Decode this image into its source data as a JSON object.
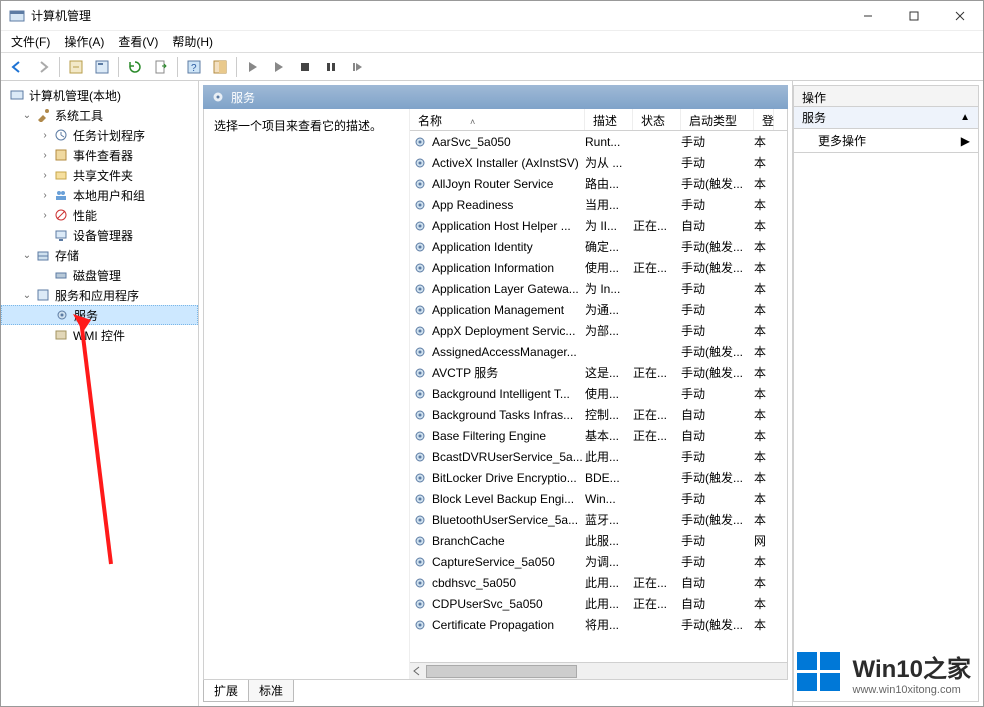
{
  "window": {
    "title": "计算机管理"
  },
  "menu": {
    "file": "文件(F)",
    "action": "操作(A)",
    "view": "查看(V)",
    "help": "帮助(H)"
  },
  "tree": {
    "root": "计算机管理(本地)",
    "sys_tools": "系统工具",
    "sys_children": {
      "task_scheduler": "任务计划程序",
      "event_viewer": "事件查看器",
      "shared_folders": "共享文件夹",
      "local_users": "本地用户和组",
      "performance": "性能",
      "device_manager": "设备管理器"
    },
    "storage": "存储",
    "storage_children": {
      "disk_mgmt": "磁盘管理"
    },
    "services_apps": "服务和应用程序",
    "services_apps_children": {
      "services": "服务",
      "wmi": "WMI 控件"
    }
  },
  "center": {
    "header": "服务",
    "description_prompt": "选择一个项目来查看它的描述。",
    "columns": {
      "name": "名称",
      "desc": "描述",
      "status": "状态",
      "startup": "启动类型",
      "logon": "登"
    },
    "tabs": {
      "extended": "扩展",
      "standard": "标准"
    }
  },
  "services": [
    {
      "name": "AarSvc_5a050",
      "desc": "Runt...",
      "status": "",
      "startup": "手动",
      "logon": "本"
    },
    {
      "name": "ActiveX Installer (AxInstSV)",
      "desc": "为从 ...",
      "status": "",
      "startup": "手动",
      "logon": "本"
    },
    {
      "name": "AllJoyn Router Service",
      "desc": "路由...",
      "status": "",
      "startup": "手动(触发...",
      "logon": "本"
    },
    {
      "name": "App Readiness",
      "desc": "当用...",
      "status": "",
      "startup": "手动",
      "logon": "本"
    },
    {
      "name": "Application Host Helper ...",
      "desc": "为 II...",
      "status": "正在...",
      "startup": "自动",
      "logon": "本"
    },
    {
      "name": "Application Identity",
      "desc": "确定...",
      "status": "",
      "startup": "手动(触发...",
      "logon": "本"
    },
    {
      "name": "Application Information",
      "desc": "使用...",
      "status": "正在...",
      "startup": "手动(触发...",
      "logon": "本"
    },
    {
      "name": "Application Layer Gatewa...",
      "desc": "为 In...",
      "status": "",
      "startup": "手动",
      "logon": "本"
    },
    {
      "name": "Application Management",
      "desc": "为通...",
      "status": "",
      "startup": "手动",
      "logon": "本"
    },
    {
      "name": "AppX Deployment Servic...",
      "desc": "为部...",
      "status": "",
      "startup": "手动",
      "logon": "本"
    },
    {
      "name": "AssignedAccessManager...",
      "desc": "",
      "status": "",
      "startup": "手动(触发...",
      "logon": "本"
    },
    {
      "name": "AVCTP 服务",
      "desc": "这是...",
      "status": "正在...",
      "startup": "手动(触发...",
      "logon": "本"
    },
    {
      "name": "Background Intelligent T...",
      "desc": "使用...",
      "status": "",
      "startup": "手动",
      "logon": "本"
    },
    {
      "name": "Background Tasks Infras...",
      "desc": "控制...",
      "status": "正在...",
      "startup": "自动",
      "logon": "本"
    },
    {
      "name": "Base Filtering Engine",
      "desc": "基本...",
      "status": "正在...",
      "startup": "自动",
      "logon": "本"
    },
    {
      "name": "BcastDVRUserService_5a...",
      "desc": "此用...",
      "status": "",
      "startup": "手动",
      "logon": "本"
    },
    {
      "name": "BitLocker Drive Encryptio...",
      "desc": "BDE...",
      "status": "",
      "startup": "手动(触发...",
      "logon": "本"
    },
    {
      "name": "Block Level Backup Engi...",
      "desc": "Win...",
      "status": "",
      "startup": "手动",
      "logon": "本"
    },
    {
      "name": "BluetoothUserService_5a...",
      "desc": "蓝牙...",
      "status": "",
      "startup": "手动(触发...",
      "logon": "本"
    },
    {
      "name": "BranchCache",
      "desc": "此服...",
      "status": "",
      "startup": "手动",
      "logon": "网"
    },
    {
      "name": "CaptureService_5a050",
      "desc": "为调...",
      "status": "",
      "startup": "手动",
      "logon": "本"
    },
    {
      "name": "cbdhsvc_5a050",
      "desc": "此用...",
      "status": "正在...",
      "startup": "自动",
      "logon": "本"
    },
    {
      "name": "CDPUserSvc_5a050",
      "desc": "此用...",
      "status": "正在...",
      "startup": "自动",
      "logon": "本"
    },
    {
      "name": "Certificate Propagation",
      "desc": "将用...",
      "status": "",
      "startup": "手动(触发...",
      "logon": "本"
    }
  ],
  "actions": {
    "header": "操作",
    "sub": "服务",
    "more": "更多操作"
  },
  "watermark": {
    "big": "Win10之家",
    "small": "www.win10xitong.com"
  }
}
